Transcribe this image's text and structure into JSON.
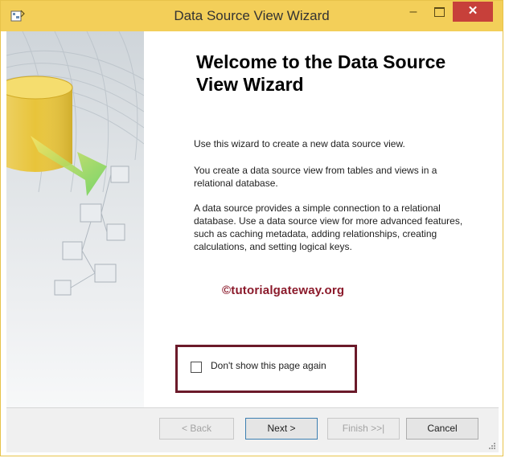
{
  "window": {
    "title": "Data Source View Wizard"
  },
  "content": {
    "heading": "Welcome to the Data Source View Wizard",
    "paragraph1": "Use this wizard to create a new data source view.",
    "paragraph2": "You create a data source view from tables and views in a relational database.",
    "paragraph3": "A data source provides a simple connection to a relational database. Use a data source view for more advanced features, such as caching metadata, adding relationships, creating calculations, and setting logical keys.",
    "watermark": "©tutorialgateway.org",
    "checkbox_label": "Don't show this page again",
    "checkbox_checked": false
  },
  "buttons": {
    "back": "< Back",
    "next": "Next >",
    "finish": "Finish >>|",
    "cancel": "Cancel"
  },
  "icons": {
    "app": "wizard-app-icon",
    "minimize": "minimize-icon",
    "maximize": "maximize-icon",
    "close": "close-icon",
    "side_art": "database-cylinder-illustration"
  },
  "colors": {
    "titlebar": "#f3cf59",
    "close_button": "#c7403a",
    "highlight_border": "#6b1a2a",
    "watermark": "#8b1a2b"
  }
}
